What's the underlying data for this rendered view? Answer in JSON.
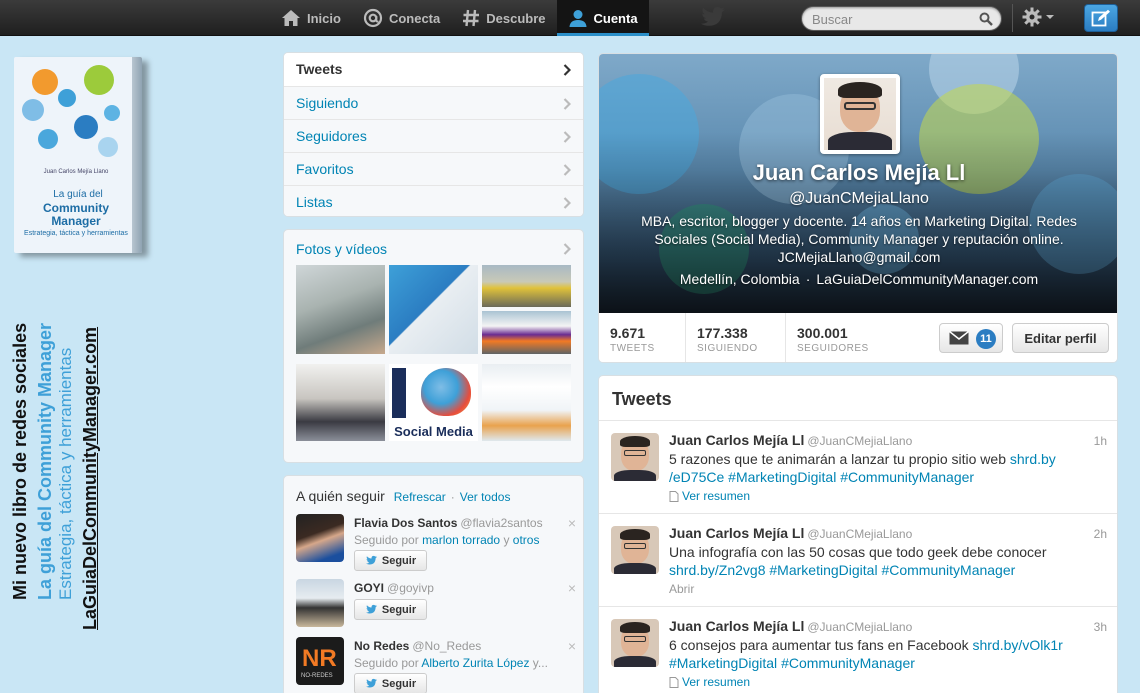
{
  "nav": {
    "items": [
      {
        "label": "Inicio",
        "icon": "home-icon"
      },
      {
        "label": "Conecta",
        "icon": "at-icon"
      },
      {
        "label": "Descubre",
        "icon": "hash-icon"
      },
      {
        "label": "Cuenta",
        "icon": "user-icon"
      }
    ],
    "active": "Cuenta",
    "search_placeholder": "Buscar"
  },
  "promo": {
    "book_author": "Juan Carlos Mejía Llano",
    "book_title_1": "La guía del",
    "book_title_2": "Community Manager",
    "book_subtitle": "Estrategia, táctica y herramientas",
    "line1": "Mi nuevo libro de redes sociales",
    "line2": "La guía del Community Manager",
    "line3": "Estrategia, táctica y herramientas",
    "line4": "LaGuiaDelCommunityManager.com"
  },
  "menu": {
    "items": [
      "Tweets",
      "Siguiendo",
      "Seguidores",
      "Favoritos",
      "Listas"
    ]
  },
  "photos": {
    "title": "Fotos y vídeos"
  },
  "who_to_follow": {
    "title": "A quién seguir",
    "refresh": "Refrescar",
    "view_all": "Ver todos",
    "follow_label": "Seguir",
    "close": "×",
    "users": [
      {
        "name": "Flavia Dos Santos",
        "screen": "@flavia2santos",
        "by_prefix": "Seguido por",
        "by1": "marlon torrado",
        "by_and": "y",
        "by2": "otros"
      },
      {
        "name": "GOYI",
        "screen": "@goyivp"
      },
      {
        "name": "No Redes",
        "screen": "@No_Redes",
        "by_prefix": "Seguido por",
        "by1": "Alberto Zurita López",
        "by_and": "y..."
      }
    ]
  },
  "profile": {
    "name": "Juan Carlos Mejía Ll",
    "handle": "@JuanCMejiaLlano",
    "bio_line1": "MBA, escritor, blogger y docente. 14 años en Marketing Digital. Redes",
    "bio_line2": "Sociales (Social Media), Community Manager y reputación online.",
    "bio_line3": "JCMejiaLlano@gmail.com",
    "location": "Medellín, Colombia",
    "separator": "·",
    "website": "LaGuiaDelCommunityManager.com",
    "stats": [
      {
        "num": "9.671",
        "label": "TWEETS"
      },
      {
        "num": "177.338",
        "label": "SIGUIENDO"
      },
      {
        "num": "300.001",
        "label": "SEGUIDORES"
      }
    ],
    "messages_count": "11",
    "edit_label": "Editar perfil"
  },
  "tweets": {
    "title": "Tweets",
    "items": [
      {
        "name": "Juan Carlos Mejía Ll",
        "screen": "@JuanCMejiaLlano",
        "time": "1h",
        "text": "5 razones que te animarán a lanzar tu propio sitio web ",
        "link1": "shrd.by",
        "link1b": "/eD75Ce",
        "tag1": "#MarketingDigital",
        "tag2": "#CommunityManager",
        "action": "Ver resumen"
      },
      {
        "name": "Juan Carlos Mejía Ll",
        "screen": "@JuanCMejiaLlano",
        "time": "2h",
        "text": "Una infografía con las 50 cosas que todo geek debe conocer",
        "link1": "shrd.by/Zn2vg8",
        "tag1": "#MarketingDigital",
        "tag2": "#CommunityManager",
        "action": "Abrir"
      },
      {
        "name": "Juan Carlos Mejía Ll",
        "screen": "@JuanCMejiaLlano",
        "time": "3h",
        "text": "6 consejos para aumentar tus fans en Facebook ",
        "link1": "shrd.by/vOlk1r",
        "tag1": "#MarketingDigital",
        "tag2": "#CommunityManager",
        "action": "Ver resumen"
      }
    ]
  },
  "colors": {
    "link": "#0084b4",
    "accent": "#2b7dc2",
    "page_bg": "#c9e6f5"
  }
}
